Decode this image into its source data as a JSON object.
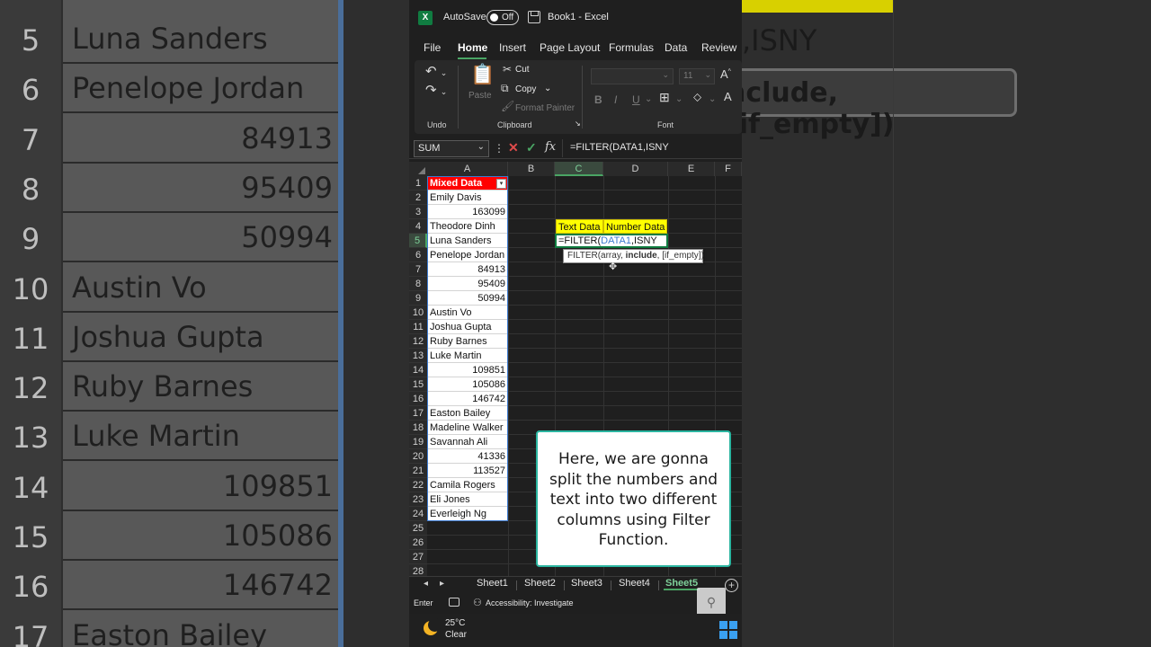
{
  "background_left": {
    "rows": [
      {
        "num": "5",
        "text": "Luna Sanders",
        "is_number": false
      },
      {
        "num": "6",
        "text": "Penelope Jordan",
        "is_number": false
      },
      {
        "num": "7",
        "text": "84913",
        "is_number": true
      },
      {
        "num": "8",
        "text": "95409",
        "is_number": true
      },
      {
        "num": "9",
        "text": "50994",
        "is_number": true
      },
      {
        "num": "10",
        "text": "Austin Vo",
        "is_number": false
      },
      {
        "num": "11",
        "text": "Joshua Gupta",
        "is_number": false
      },
      {
        "num": "12",
        "text": "Ruby Barnes",
        "is_number": false
      },
      {
        "num": "13",
        "text": "Luke Martin",
        "is_number": false
      },
      {
        "num": "14",
        "text": "109851",
        "is_number": true
      },
      {
        "num": "15",
        "text": "105086",
        "is_number": true
      },
      {
        "num": "16",
        "text": "146742",
        "is_number": true
      },
      {
        "num": "17",
        "text": "Easton Bailey",
        "is_number": false
      }
    ]
  },
  "background_right": {
    "formula_text": ",ISNY",
    "tooltip_text": "nclude, [if_empty])"
  },
  "titlebar": {
    "autosave_label": "AutoSave",
    "toggle_state": "Off",
    "doc_title": "Book1  -  Excel"
  },
  "menu": {
    "items": [
      "File",
      "Home",
      "Insert",
      "Page Layout",
      "Formulas",
      "Data",
      "Review"
    ]
  },
  "ribbon": {
    "undo_label": "Undo",
    "paste_label": "Paste",
    "cut_label": "Cut",
    "copy_label": "Copy",
    "format_painter_label": "Format Painter",
    "clipboard_label": "Clipboard",
    "font_size": "11",
    "font_label": "Font",
    "bold": "B",
    "italic": "I",
    "underline": "U"
  },
  "formula_bar": {
    "name_box": "SUM",
    "formula": "=FILTER(DATA1,ISNY"
  },
  "grid": {
    "columns": [
      "A",
      "B",
      "C",
      "D",
      "E",
      "F"
    ],
    "selected_column": "C",
    "selected_row": "5",
    "row_numbers": [
      "1",
      "2",
      "3",
      "4",
      "5",
      "6",
      "7",
      "8",
      "9",
      "10",
      "11",
      "12",
      "13",
      "14",
      "15",
      "16",
      "17",
      "18",
      "19",
      "20",
      "21",
      "22",
      "23",
      "24",
      "25",
      "26",
      "27",
      "28"
    ],
    "column_a": [
      {
        "value": "Mixed Data",
        "is_number": false,
        "header": true
      },
      {
        "value": "Emily Davis",
        "is_number": false
      },
      {
        "value": "163099",
        "is_number": true
      },
      {
        "value": "Theodore Dinh",
        "is_number": false
      },
      {
        "value": "Luna Sanders",
        "is_number": false
      },
      {
        "value": "Penelope Jordan",
        "is_number": false
      },
      {
        "value": "84913",
        "is_number": true
      },
      {
        "value": "95409",
        "is_number": true
      },
      {
        "value": "50994",
        "is_number": true
      },
      {
        "value": "Austin Vo",
        "is_number": false
      },
      {
        "value": "Joshua Gupta",
        "is_number": false
      },
      {
        "value": "Ruby Barnes",
        "is_number": false
      },
      {
        "value": "Luke Martin",
        "is_number": false
      },
      {
        "value": "109851",
        "is_number": true
      },
      {
        "value": "105086",
        "is_number": true
      },
      {
        "value": "146742",
        "is_number": true
      },
      {
        "value": "Easton Bailey",
        "is_number": false
      },
      {
        "value": "Madeline Walker",
        "is_number": false
      },
      {
        "value": "Savannah Ali",
        "is_number": false
      },
      {
        "value": "41336",
        "is_number": true
      },
      {
        "value": "113527",
        "is_number": true
      },
      {
        "value": "Camila Rogers",
        "is_number": false
      },
      {
        "value": "Eli Jones",
        "is_number": false
      },
      {
        "value": "Everleigh Ng",
        "is_number": false
      }
    ],
    "c4": "Text Data",
    "d4": "Number Data",
    "c5_prefix": "=FILTER(",
    "c5_ref": "DATA1",
    "c5_suffix": ",ISNY",
    "tooltip_prefix": "FILTER(array, ",
    "tooltip_bold": "include",
    "tooltip_suffix": ", [if_empty])"
  },
  "callout": {
    "text": "Here, we are gonna split the numbers and text into two different columns using Filter Function."
  },
  "sheets": {
    "tabs": [
      "Sheet1",
      "Sheet2",
      "Sheet3",
      "Sheet4",
      "Sheet5"
    ],
    "active": "Sheet5"
  },
  "status": {
    "mode": "Enter",
    "accessibility": "Accessibility: Investigate"
  },
  "taskbar": {
    "temperature": "25°C",
    "weather": "Clear"
  },
  "colors": {
    "excel_green": "#107c41",
    "header_red": "#ff0000",
    "highlight_yellow": "#ffff00",
    "callout_border": "#2ab5a0"
  }
}
